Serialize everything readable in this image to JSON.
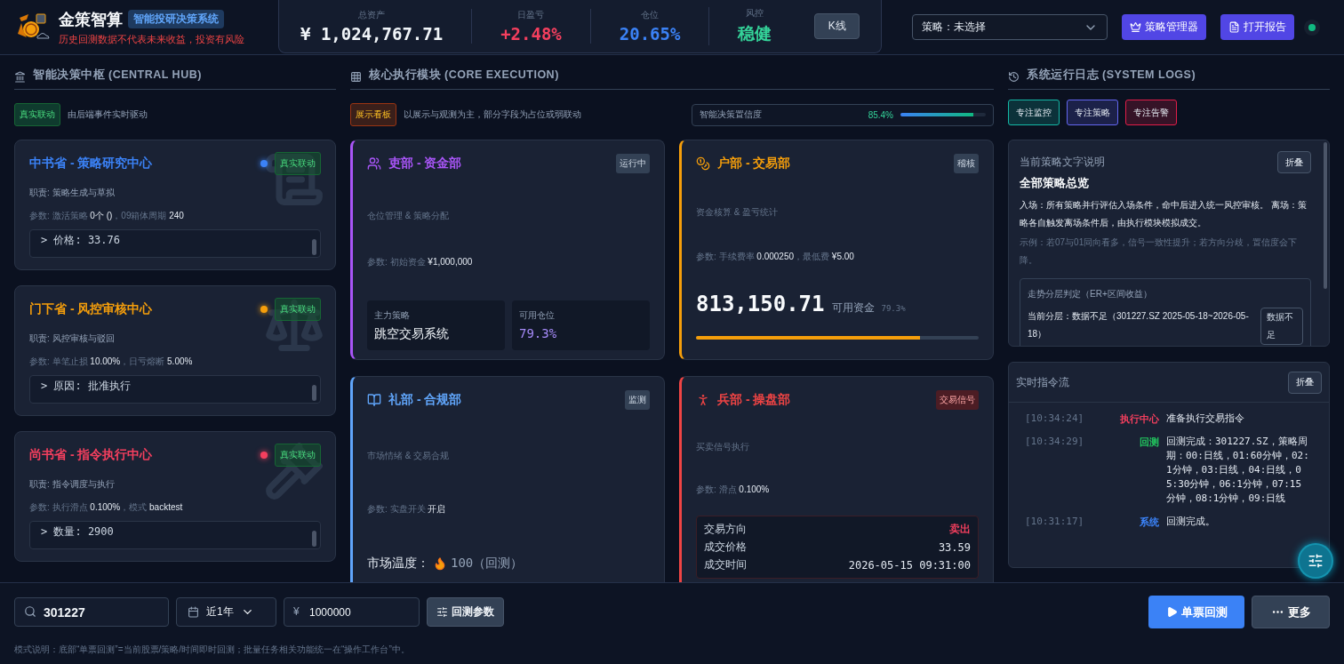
{
  "header": {
    "app_name": "金策智算",
    "app_badge": "智能投研决策系统",
    "disclaimer": "历史回测数据不代表未来收益，投资有风险",
    "stats": [
      {
        "label": "总资产",
        "value": "¥ 1,024,767.71",
        "color": "#f1f5f9"
      },
      {
        "label": "日盈亏",
        "value": "+2.48%",
        "color": "#f43f5e"
      },
      {
        "label": "仓位",
        "value": "20.65%",
        "color": "#3b82f6"
      },
      {
        "label": "风控",
        "value": "稳健",
        "color": "#34d399"
      }
    ],
    "kline_button": "K线",
    "strategy_select": "策略：未选择",
    "buttons": [
      {
        "label": "策略管理器",
        "kind": "manager"
      },
      {
        "label": "打开报告",
        "kind": "report"
      }
    ],
    "online": true
  },
  "hub": {
    "title": "智能决策中枢 (CENTRAL HUB)",
    "tag": "真实联动",
    "tag_note": "由后端事件实时驱动",
    "cards": [
      {
        "title": "中书省 - 策略研究中心",
        "color": "#3b82f6",
        "kind": "scroll",
        "badge": "真实联动",
        "duty": "职责: 策略生成与草拟",
        "params": "参数: 激活策略 **0个 ()**，09箱体周期 **240**",
        "console": "> 价格: 33.76"
      },
      {
        "title": "门下省 - 风控审核中心",
        "color": "#f59e0b",
        "kind": "scale",
        "badge": "真实联动",
        "duty": "职责: 风控审核与驳回",
        "params": "参数: 单笔止损 **10.00%**，日亏熔断 **5.00%**",
        "console": "> 原因: 批准执行"
      },
      {
        "title": "尚书省 - 指令执行中心",
        "color": "#f43f5e",
        "kind": "gavel",
        "badge": "真实联动",
        "duty": "职责: 指令调度与执行",
        "params": "参数: 执行滑点 **0.100%**，模式 **backtest**",
        "console": "> 数量: 2900"
      }
    ]
  },
  "core": {
    "title": "核心执行模块 (CORE EXECUTION)",
    "tag": "展示看板",
    "tag_note": "以展示与观测为主，部分字段为占位或弱联动",
    "confidence": {
      "label": "智能决策置信度",
      "reading": "85.4%",
      "level": 0.85
    },
    "cards": [
      {
        "kind": "stats",
        "title": "吏部 - 资金部",
        "color": "#a855f7",
        "badge": "运行中",
        "alert": false,
        "subtitle": "仓位管理 & 策略分配",
        "params": "参数: 初始资金 **¥1,000,000**",
        "boxes": [
          {
            "label": "主力策略",
            "value": "跳空交易系统"
          },
          {
            "label": "可用仓位",
            "value": "79.3%"
          }
        ]
      },
      {
        "kind": "funds",
        "title": "户部 - 交易部",
        "color": "#f59e0b",
        "badge": "稽核",
        "alert": false,
        "subtitle": "资金核算 & 盈亏统计",
        "params": "参数: 手续费率 **0.000250**，最低费 **¥5.00**",
        "amount": "813,150.71",
        "amount_label": "可用资金",
        "amount_share": "79.3%",
        "level": 0.793
      },
      {
        "kind": "sentiment",
        "title": "礼部 - 合规部",
        "color": "#60a5fa",
        "badge": "监测",
        "alert": false,
        "subtitle": "市场情绪 & 交易合规",
        "params": "参数: 实盘开关 **开启**",
        "temperature": {
          "label": "市场温度：",
          "value": "100（回测）"
        }
      },
      {
        "kind": "signal",
        "title": "兵部 - 操盘部",
        "color": "#ef4444",
        "badge": "交易信号",
        "alert": true,
        "subtitle": "买卖信号执行",
        "params": "参数: 滑点 **0.100%**",
        "trade": [
          {
            "label": "交易方向",
            "value": "卖出",
            "highlight": true
          },
          {
            "label": "成交价格",
            "value": "33.59",
            "highlight": false
          },
          {
            "label": "成交时间",
            "value": "2026-05-15 09:31:00",
            "highlight": false
          }
        ]
      }
    ]
  },
  "logs": {
    "title": "系统运行日志 (SYSTEM LOGS)",
    "filters": [
      {
        "label": "专注监控",
        "color": "#14b8a6"
      },
      {
        "label": "专注策略",
        "color": "#6366f1"
      },
      {
        "label": "专注告警",
        "color": "#e11d48"
      }
    ],
    "strategy": {
      "title": "当前策略文字说明",
      "collapse": "折叠",
      "heading": "全部策略总览",
      "body": "入场：所有策略并行评估入场条件，命中后进入统一风控审核。 离场：策略各自触发离场条件后，由执行模块模拟成交。",
      "example": "示例：若07与01同向看多，信号一致性提升；若方向分歧，置信度会下降。",
      "trend": {
        "title": "走势分层判定（ER+区间收益）",
        "text": "当前分层：数据不足（301227.SZ 2025-05-18~2026-05-18）",
        "badge": "数据不足"
      }
    },
    "stream": {
      "title": "实时指令流",
      "collapse": "折叠",
      "entries": [
        {
          "time": "[10:34:24]",
          "source": "执行中心",
          "color": "#f43f5e",
          "message": "准备执行交易指令"
        },
        {
          "time": "[10:34:29]",
          "source": "回测",
          "color": "#22c55e",
          "message": "回测完成：301227.SZ，策略周期：00:日线，01:60分钟，02:1分钟，03:日线，04:日线，05:30分钟，06:1分钟，07:15分钟，08:1分钟，09:日线"
        },
        {
          "time": "[10:31:17]",
          "source": "系统",
          "color": "#3b82f6",
          "message": "回测完成。"
        }
      ]
    }
  },
  "bottom": {
    "search": "301227",
    "period": "近1年",
    "capital_prefix": "¥",
    "capital": "1000000",
    "params_button": "回测参数",
    "run_button": "单票回测",
    "more_button": "更多",
    "note": "模式说明：底部“单票回测”=当前股票/策略/时间即时回测；批量任务相关功能统一在“操作工作台”中。"
  }
}
